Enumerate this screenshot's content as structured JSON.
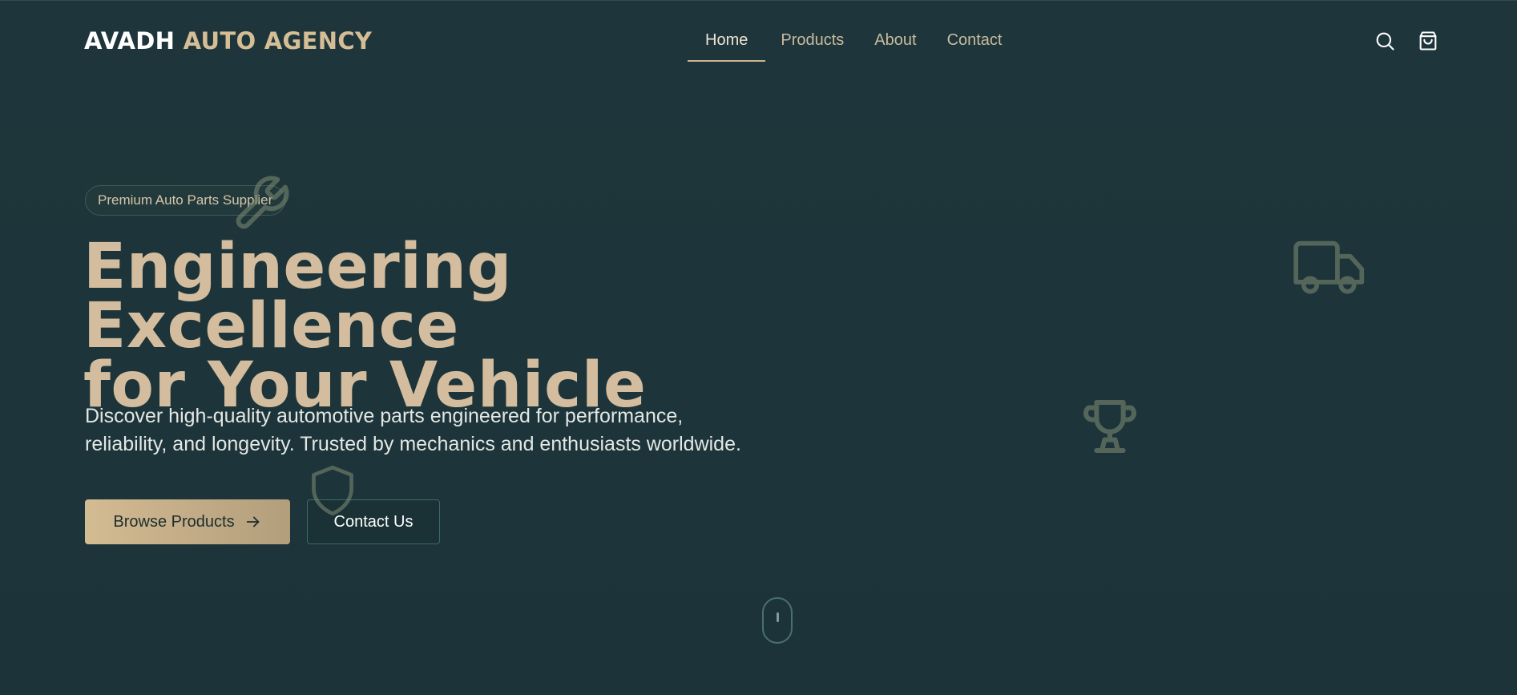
{
  "header": {
    "logo_part1": "AVADH",
    "logo_part2": "AUTO AGENCY",
    "nav": [
      "Home",
      "Products",
      "About",
      "Contact"
    ],
    "active_nav": "Home",
    "icons": [
      "search-icon",
      "shopping-bag-icon"
    ]
  },
  "hero": {
    "badge": "Premium Auto Parts Supplier",
    "headline_line1": "Engineering Excellence",
    "headline_line2": "for Your Vehicle",
    "subtext": "Discover high-quality automotive parts engineered for performance, reliability, and longevity. Trusted by mechanics and enthusiasts worldwide.",
    "primary_button": "Browse Products",
    "secondary_button": "Contact Us"
  },
  "decorative_icons": [
    "wrench-icon",
    "truck-icon",
    "trophy-icon",
    "shield-icon"
  ],
  "colors": {
    "background": "#1d353a",
    "accent_gold": "#d3bd9e",
    "text_light": "#e3e7e4"
  }
}
